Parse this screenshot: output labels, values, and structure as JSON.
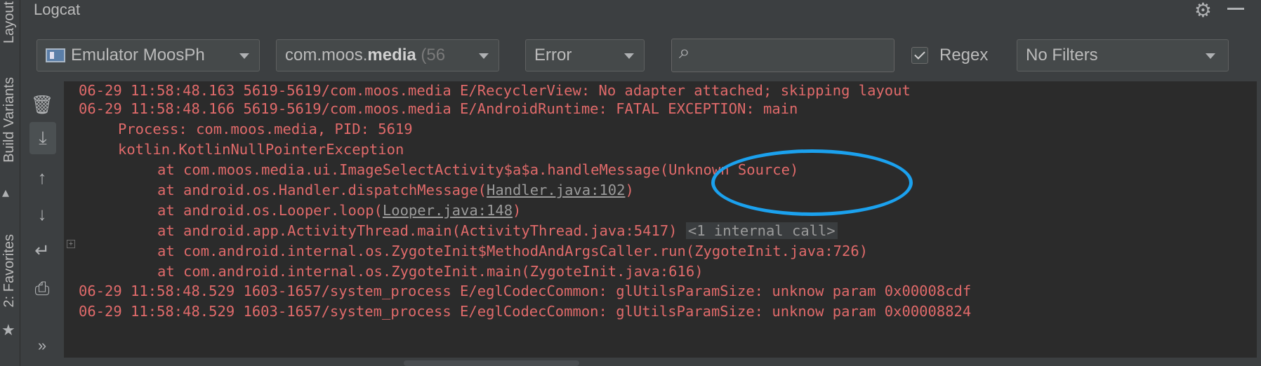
{
  "sidebar": {
    "layout_label": "Layout",
    "build_variants_label": "Build Variants",
    "favorites_label": "2: Favorites"
  },
  "header": {
    "title": "Logcat"
  },
  "toolbar": {
    "device": "Emulator MoosPh",
    "process_prefix": "com.moos.",
    "process_bold": "media",
    "process_suffix": " (56",
    "level": "Error",
    "search_placeholder": "",
    "regex_label": "Regex",
    "regex_checked": true,
    "filter": "No Filters"
  },
  "gutter_icons": [
    "trash-icon",
    "scroll-to-end-icon",
    "up-arrow-icon",
    "down-arrow-icon",
    "soft-wrap-icon",
    "print-icon",
    "expand-icon"
  ],
  "log": {
    "lines": [
      "06-29 11:58:48.163 5619-5619/com.moos.media E/RecyclerView: No adapter attached; skipping layout",
      "06-29 11:58:48.166 5619-5619/com.moos.media E/AndroidRuntime: FATAL EXCEPTION: main",
      "Process: com.moos.media, PID: 5619",
      "kotlin.KotlinNullPointerException",
      "at com.moos.media.ui.ImageSelectActivity$a$a.handleMessage(Unknown Source)",
      "at android.os.Handler.dispatchMessage(",
      "Handler.java:102",
      ")",
      "at android.os.Looper.loop(",
      "Looper.java:148",
      ")",
      "at android.app.ActivityThread.main(ActivityThread.java:5417)",
      "<1 internal call>",
      "at com.android.internal.os.ZygoteInit$MethodAndArgsCaller.run(ZygoteInit.java:726)",
      "at com.android.internal.os.ZygoteInit.main(ZygoteInit.java:616)",
      "06-29 11:58:48.529 1603-1657/system_process E/eglCodecCommon: glUtilsParamSize: unknow param 0x00008cdf",
      "06-29 11:58:48.529 1603-1657/system_process E/eglCodecCommon: glUtilsParamSize: unknow param 0x00008824"
    ]
  },
  "colors": {
    "error_text": "#e06a6a",
    "highlight": "#1ba1ee",
    "log_background": "#2b2b2b"
  }
}
